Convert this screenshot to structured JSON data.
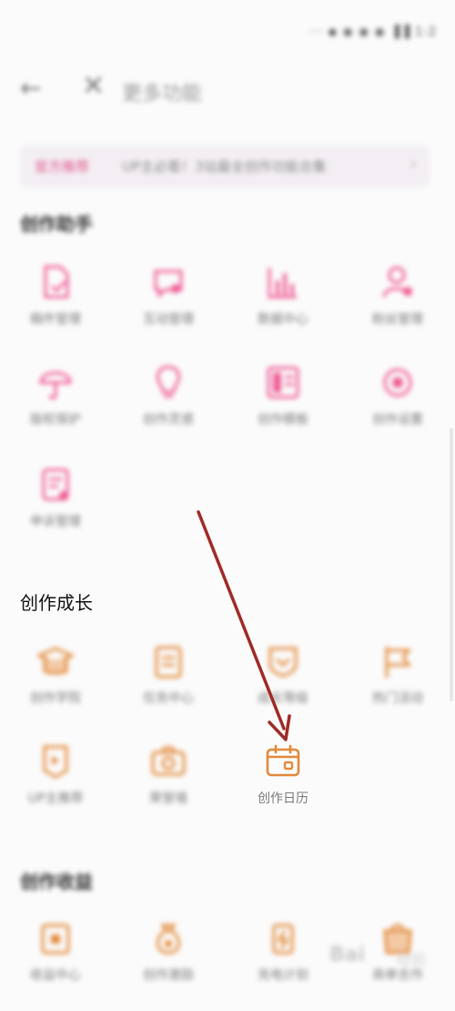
{
  "status_bar": {
    "text": "··· ◆ ◉ ◉ ◉ ▐▐ 1:2"
  },
  "nav": {
    "back_icon": "←",
    "close_icon": "✕",
    "title": "更多功能"
  },
  "banner": {
    "tag": "官方推荐",
    "text": "UP主必看！3站最全创作功能合集",
    "arrow": "›"
  },
  "sections": {
    "assistant": {
      "title": "创作助手",
      "items": [
        {
          "label": "稿件管理"
        },
        {
          "label": "互动管理"
        },
        {
          "label": "数据中心"
        },
        {
          "label": "粉丝管理"
        },
        {
          "label": "版权保护"
        },
        {
          "label": "创作灵感"
        },
        {
          "label": "创作模板"
        },
        {
          "label": "创作设置"
        },
        {
          "label": "申诉管理"
        }
      ]
    },
    "growth": {
      "title": "创作成长",
      "items": [
        {
          "label": "创作学院"
        },
        {
          "label": "任务中心"
        },
        {
          "label": "成长等级"
        },
        {
          "label": "热门活动"
        },
        {
          "label": "UP主推荐"
        },
        {
          "label": "荣誉墙"
        },
        {
          "label": "创作日历"
        }
      ]
    },
    "income": {
      "title": "创作收益",
      "items": [
        {
          "label": "收益中心"
        },
        {
          "label": "创作激励"
        },
        {
          "label": "充电计划"
        },
        {
          "label": "商单合作"
        }
      ]
    }
  },
  "watermark": {
    "brand": "Bai",
    "sub": "经验"
  },
  "colors": {
    "pink": "#ef5c95",
    "orange": "#e28a3a",
    "arrow": "#a02a26"
  }
}
